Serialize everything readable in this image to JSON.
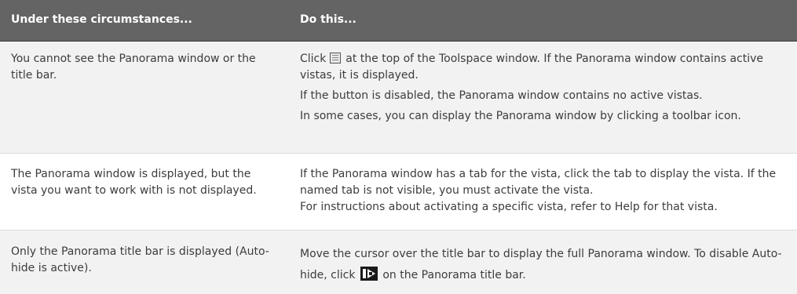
{
  "header": {
    "col1": "Under these circumstances...",
    "col2": "Do this..."
  },
  "rows": [
    {
      "circumstance": "You cannot see the Panorama window or the title bar.",
      "action_lines": [
        {
          "before_icon": "Click ",
          "icon": "panorama-window-icon",
          "after_icon": " at the top of the Toolspace window. If the Panorama window contains active vistas, it is displayed."
        },
        {
          "text": "If the button is disabled, the Panorama window contains no active vistas."
        },
        {
          "text": "In some cases, you can display the Panorama window by clicking a toolbar icon."
        }
      ]
    },
    {
      "circumstance": "The Panorama window is displayed, but the vista you want to work with is not displayed.",
      "action_lines": [
        {
          "text": "If the Panorama window has a tab for the vista, click the tab to display the vista. If the named tab is not visible, you must activate the vista."
        },
        {
          "text": "For instructions about activating a specific vista, refer to Help for that vista."
        }
      ]
    },
    {
      "circumstance": "Only the Panorama title bar is displayed (Auto-hide is active).",
      "action_lines": [
        {
          "before_icon": "Move the cursor over the title bar to display the full Panorama window. To disable Auto-hide, click ",
          "icon": "auto-hide-icon",
          "after_icon": " on the Panorama title bar."
        }
      ]
    }
  ]
}
